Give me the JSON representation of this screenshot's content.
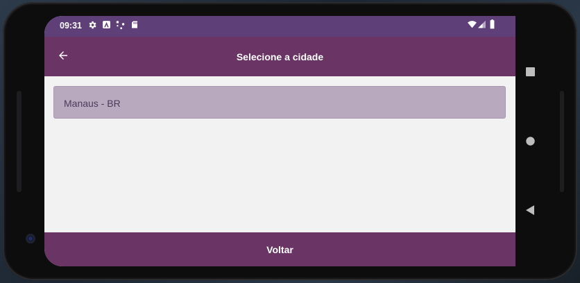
{
  "status_bar": {
    "time": "09:31",
    "left_icons": [
      "settings-icon",
      "app-icon",
      "hotspot-icon",
      "sd-card-icon"
    ],
    "right_icons": [
      "wifi-icon",
      "cell-signal-icon",
      "battery-icon"
    ]
  },
  "app_bar": {
    "title": "Selecione a cidade",
    "back_icon": "arrow-left-icon"
  },
  "city_list": {
    "items": [
      {
        "label": "Manaus - BR"
      }
    ]
  },
  "bottom_bar": {
    "label": "Voltar"
  },
  "nav_bar": {
    "buttons": [
      "recents-square-icon",
      "home-circle-icon",
      "back-triangle-icon"
    ]
  },
  "colors": {
    "status_bar": "#5e3f77",
    "app_bar": "#6a3464",
    "list_item": "#b9a9bf",
    "content_bg": "#f2f2f2"
  }
}
